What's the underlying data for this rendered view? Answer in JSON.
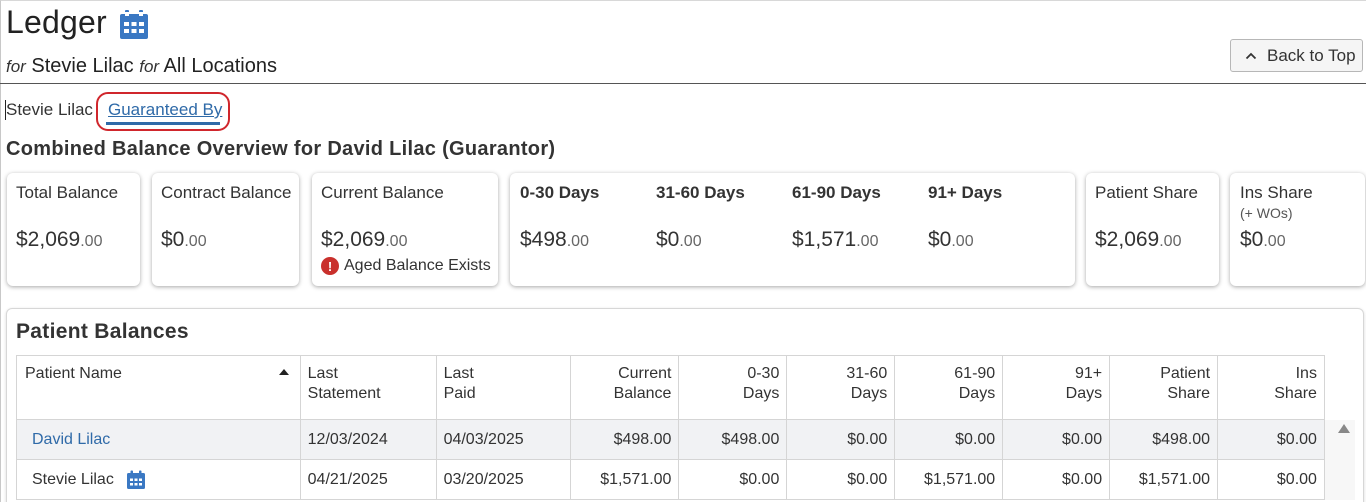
{
  "header": {
    "title": "Ledger",
    "for_word": "for",
    "patient": "Stevie Lilac",
    "for_word_2": "for",
    "location": "All Locations",
    "back_label": "Back to Top"
  },
  "tabs": {
    "patient_tab": "Stevie Lilac",
    "guarantor_tab": "Guaranteed By"
  },
  "overview": {
    "title": "Combined Balance Overview for David Lilac (Guarantor)",
    "cards": {
      "total": {
        "label": "Total Balance",
        "dollars": "$2,069",
        "cents": ".00"
      },
      "contract": {
        "label": "Contract Balance",
        "dollars": "$0",
        "cents": ".00"
      },
      "current": {
        "label": "Current Balance",
        "dollars": "$2,069",
        "cents": ".00",
        "warning": "Aged Balance Exists"
      },
      "aging": [
        {
          "label": "0-30 Days",
          "dollars": "$498",
          "cents": ".00"
        },
        {
          "label": "31-60 Days",
          "dollars": "$0",
          "cents": ".00"
        },
        {
          "label": "61-90 Days",
          "dollars": "$1,571",
          "cents": ".00"
        },
        {
          "label": "91+ Days",
          "dollars": "$0",
          "cents": ".00"
        }
      ],
      "patient_share": {
        "label": "Patient Share",
        "dollars": "$2,069",
        "cents": ".00"
      },
      "ins_share": {
        "label": "Ins Share",
        "sub": "(+ WOs)",
        "dollars": "$0",
        "cents": ".00"
      }
    }
  },
  "patient_balances": {
    "title": "Patient Balances",
    "columns": {
      "name": "Patient Name",
      "last_statement_1": "Last",
      "last_statement_2": "Statement",
      "last_paid_1": "Last",
      "last_paid_2": "Paid",
      "current_1": "Current",
      "current_2": "Balance",
      "d0_1": "0-30",
      "d0_2": "Days",
      "d31_1": "31-60",
      "d31_2": "Days",
      "d61_1": "61-90",
      "d61_2": "Days",
      "d91_1": "91+",
      "d91_2": "Days",
      "ps_1": "Patient",
      "ps_2": "Share",
      "is_1": "Ins",
      "is_2": "Share"
    },
    "rows": [
      {
        "name": "David Lilac",
        "last_statement": "12/03/2024",
        "last_paid": "04/03/2025",
        "current": "$498.00",
        "d0": "$498.00",
        "d31": "$0.00",
        "d61": "$0.00",
        "d91": "$0.00",
        "patient_share": "$498.00",
        "ins_share": "$0.00"
      },
      {
        "name": "Stevie Lilac",
        "last_statement": "04/21/2025",
        "last_paid": "03/20/2025",
        "current": "$1,571.00",
        "d0": "$0.00",
        "d31": "$0.00",
        "d61": "$1,571.00",
        "d91": "$0.00",
        "patient_share": "$1,571.00",
        "ins_share": "$0.00"
      }
    ]
  },
  "colors": {
    "link": "#2f6aa8",
    "aging_0_30": "#2b8a2b",
    "aging_31_60": "#e8b92f",
    "aging_61_90": "#e28b3b",
    "aging_91_plus": "#c0313a",
    "highlight": "#d0262c"
  },
  "icons": {
    "title_icon": "calendar-icon",
    "back_icon": "chevron-up-icon",
    "warning_icon": "exclamation-circle-icon",
    "row_icon": "calendar-icon"
  }
}
